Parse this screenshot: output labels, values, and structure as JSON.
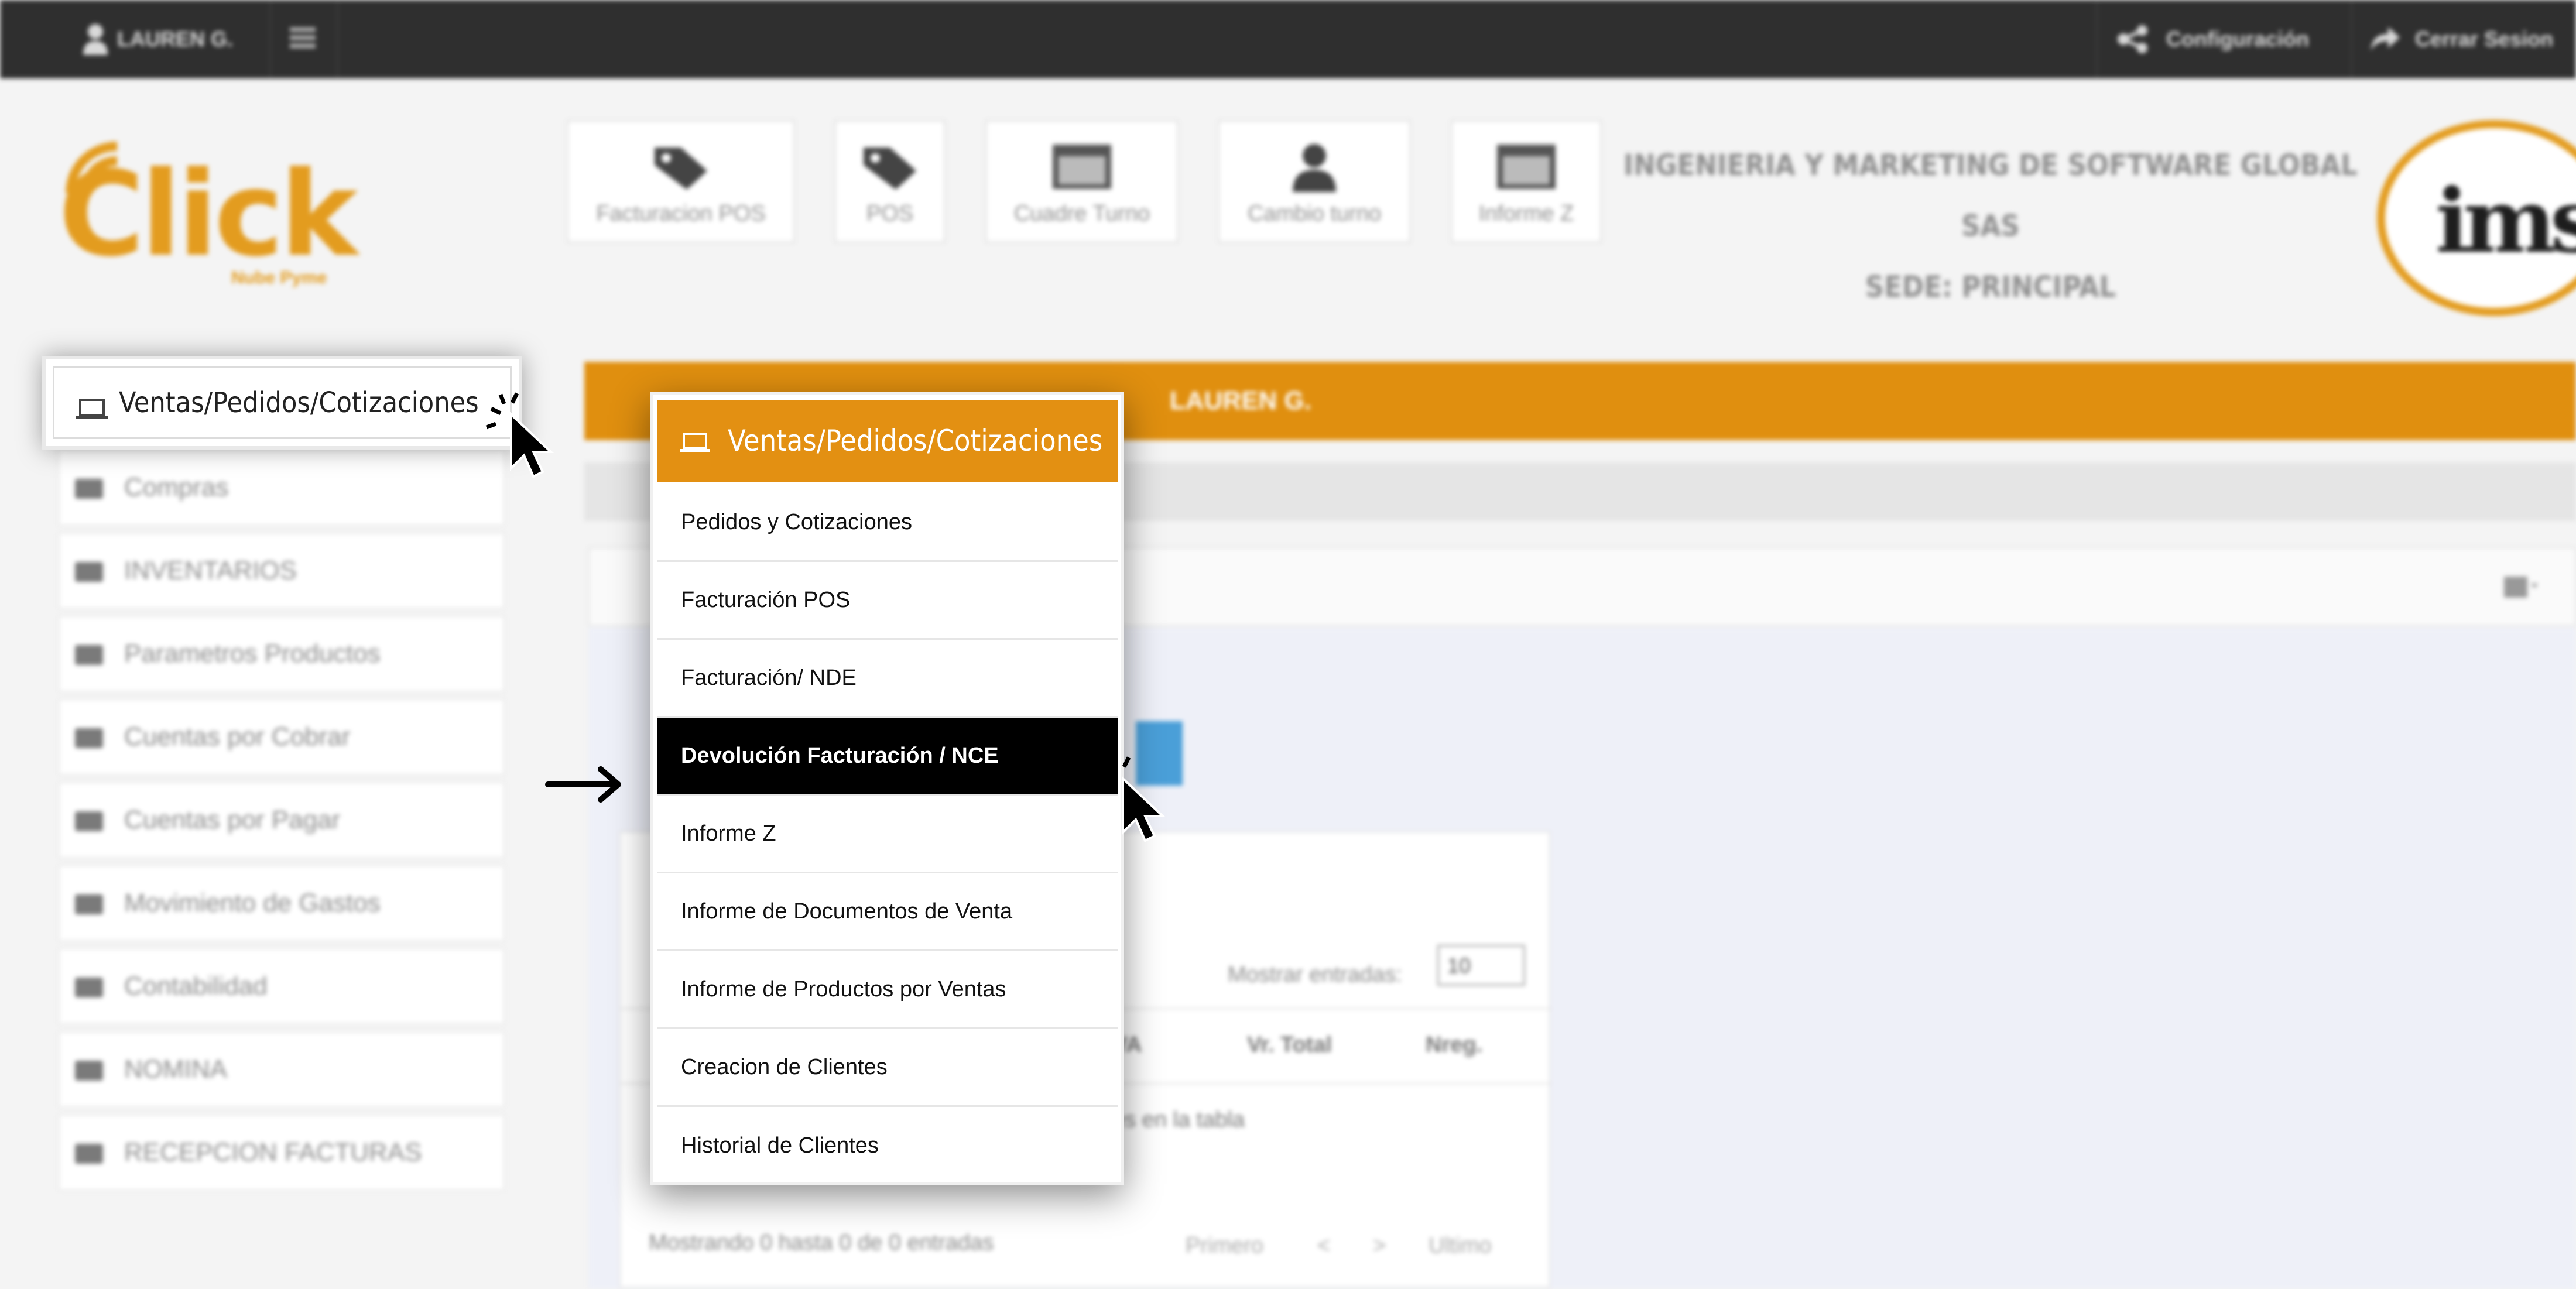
{
  "topbar": {
    "user": "LAUREN G.",
    "config_label": "Configuración",
    "logout_label": "Cerrar Sesion"
  },
  "logo": {
    "brand": "Click",
    "tagline": "Nube Pyme"
  },
  "shortcuts": [
    {
      "label": "Facturacion POS",
      "icon": "tag-icon"
    },
    {
      "label": "POS",
      "icon": "tag-icon"
    },
    {
      "label": "Cuadre Turno",
      "icon": "calendar-icon"
    },
    {
      "label": "Cambio turno",
      "icon": "user-icon"
    },
    {
      "label": "Informe Z",
      "icon": "calendar-icon"
    }
  ],
  "company": {
    "name": "INGENIERIA Y MARKETING DE SOFTWARE GLOBAL SAS",
    "branch": "SEDE: PRINCIPAL",
    "logo_text": "ims"
  },
  "sidebar": {
    "items": [
      {
        "label": "Ventas/Pedidos/Cotizaciones",
        "icon": "laptop-icon"
      },
      {
        "label": "Compras",
        "icon": "cart-icon"
      },
      {
        "label": "INVENTARIOS",
        "icon": "inbox-icon"
      },
      {
        "label": "Parametros Productos",
        "icon": "briefcase-icon"
      },
      {
        "label": "Cuentas por Cobrar",
        "icon": "briefcase-icon"
      },
      {
        "label": "Cuentas por Pagar",
        "icon": "briefcase-icon"
      },
      {
        "label": "Movimiento de Gastos",
        "icon": "columns-icon"
      },
      {
        "label": "Contabilidad",
        "icon": "image-icon"
      },
      {
        "label": "NOMINA",
        "icon": "columns-icon"
      },
      {
        "label": "RECEPCION FACTURAS",
        "icon": "columns-icon"
      }
    ]
  },
  "main": {
    "orange_bar_text": "LAUREN G.",
    "table": {
      "show_entries_label": "Mostrar entradas:",
      "show_entries_value": "10",
      "columns": [
        "IVA",
        "Vr. Total",
        "Nreg."
      ],
      "empty_text": "es en la tabla",
      "footer_text": "Mostrando 0 hasta 0 de 0 entradas",
      "pagination": [
        "Primero",
        "<",
        ">",
        "Ultimo"
      ]
    }
  },
  "dropdown": {
    "title": "Ventas/Pedidos/Cotizaciones",
    "items": [
      {
        "label": "Pedidos y Cotizaciones",
        "active": false
      },
      {
        "label": "Facturación POS",
        "active": false
      },
      {
        "label": "Facturación/ NDE",
        "active": false
      },
      {
        "label": "Devolución Facturación / NCE",
        "active": true
      },
      {
        "label": "Informe Z",
        "active": false
      },
      {
        "label": "Informe de Documentos de Venta",
        "active": false
      },
      {
        "label": "Informe de Productos por Ventas",
        "active": false
      },
      {
        "label": "Creacion de Clientes",
        "active": false
      },
      {
        "label": "Historial de Clientes",
        "active": false
      }
    ]
  },
  "colors": {
    "accent": "#e39012",
    "topbar": "#2f2f2f",
    "active_item": "#000000"
  }
}
